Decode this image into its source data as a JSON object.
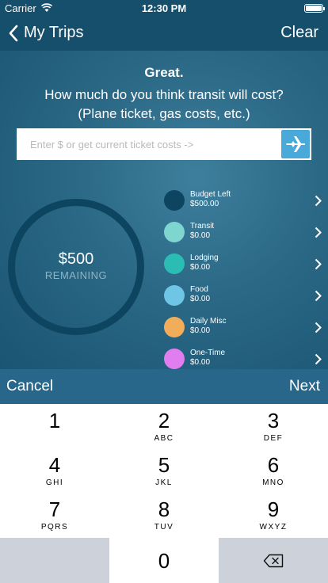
{
  "status_bar": {
    "carrier": "Carrier",
    "time": "12:30 PM"
  },
  "nav": {
    "back_label": "My Trips",
    "clear_label": "Clear"
  },
  "prompt": {
    "greeting": "Great.",
    "question_line1": "How much do you think transit will cost?",
    "question_line2": "(Plane ticket, gas costs, etc.)"
  },
  "cost_input": {
    "value": "",
    "placeholder": "Enter $ or get current ticket costs ->"
  },
  "budget": {
    "amount": "$500",
    "label": "REMAINING"
  },
  "categories": [
    {
      "name": "Budget Left",
      "amount": "$500.00",
      "color": "#0d4561"
    },
    {
      "name": "Transit",
      "amount": "$0.00",
      "color": "#7fd6d1"
    },
    {
      "name": "Lodging",
      "amount": "$0.00",
      "color": "#2bbdb3"
    },
    {
      "name": "Food",
      "amount": "$0.00",
      "color": "#6ec5e6"
    },
    {
      "name": "Daily Misc",
      "amount": "$0.00",
      "color": "#f2ad5a"
    },
    {
      "name": "One-Time",
      "amount": "$0.00",
      "color": "#e07ef0"
    }
  ],
  "actions": {
    "cancel_label": "Cancel",
    "next_label": "Next"
  },
  "keypad": {
    "keys": [
      {
        "digit": "1",
        "letters": ""
      },
      {
        "digit": "2",
        "letters": "ABC"
      },
      {
        "digit": "3",
        "letters": "DEF"
      },
      {
        "digit": "4",
        "letters": "GHI"
      },
      {
        "digit": "5",
        "letters": "JKL"
      },
      {
        "digit": "6",
        "letters": "MNO"
      },
      {
        "digit": "7",
        "letters": "PQRS"
      },
      {
        "digit": "8",
        "letters": "TUV"
      },
      {
        "digit": "9",
        "letters": "WXYZ"
      },
      {
        "digit": "0",
        "letters": ""
      }
    ]
  }
}
